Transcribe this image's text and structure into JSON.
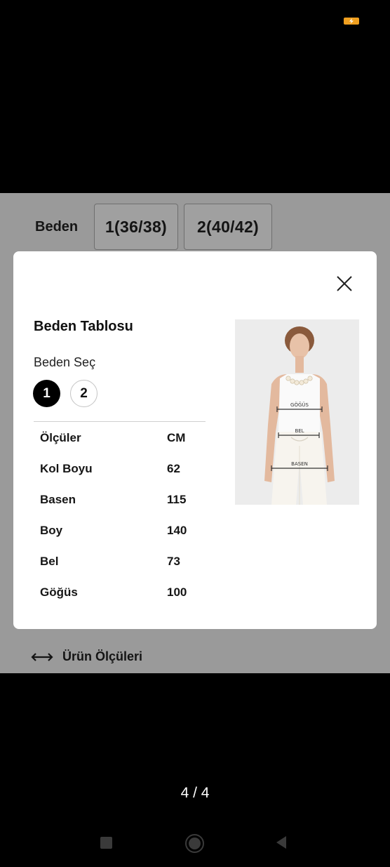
{
  "page": {
    "size_selector": {
      "label": "Beden",
      "options": [
        "1(36/38)",
        "2(40/42)"
      ]
    },
    "footer_link": {
      "label": "Ürün Ölçüleri"
    }
  },
  "modal": {
    "title": "Beden Tablosu",
    "select_label": "Beden Seç",
    "sizes": [
      {
        "label": "1",
        "selected": true
      },
      {
        "label": "2",
        "selected": false
      }
    ],
    "table": {
      "headers": [
        "Ölçüler",
        "CM"
      ],
      "rows": [
        {
          "name": "Kol Boyu",
          "value": "62"
        },
        {
          "name": "Basen",
          "value": "115"
        },
        {
          "name": "Boy",
          "value": "140"
        },
        {
          "name": "Bel",
          "value": "73"
        },
        {
          "name": "Göğüs",
          "value": "100"
        }
      ]
    },
    "image": {
      "labels": [
        "GÖĞÜS",
        "BEL",
        "BASEN"
      ]
    }
  },
  "viewer": {
    "counter": "4 / 4"
  },
  "colors": {
    "backdrop": "#9a9a9a",
    "battery": "#f0a020",
    "selected_chip": "#000000"
  },
  "icons": {
    "close": "close-icon",
    "arrows": "horizontal-arrows-icon",
    "nav_recent": "square-icon",
    "nav_home": "circle-icon",
    "nav_back": "triangle-back-icon"
  }
}
